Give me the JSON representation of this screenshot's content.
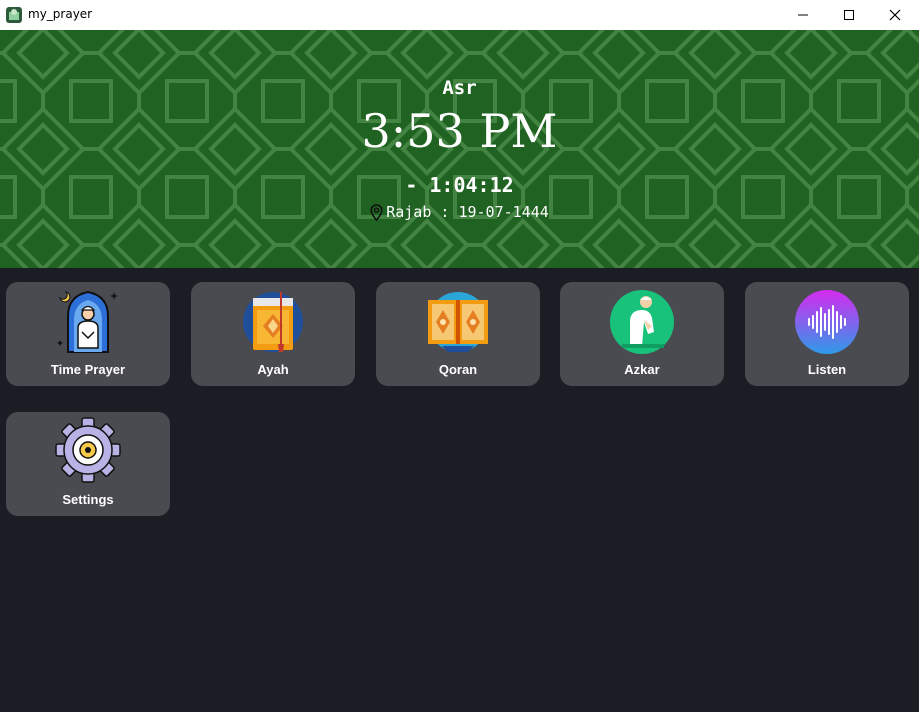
{
  "window": {
    "title": "my_prayer",
    "controls": [
      "minimize",
      "maximize",
      "close"
    ]
  },
  "header": {
    "prayer_name": "Asr",
    "prayer_time": "3:53 PM",
    "remaining": "- 1:04:12",
    "date": "Rajab : 19-07-1444",
    "background_color": "#1f6221",
    "location_icon": "location-pin-icon"
  },
  "menu": {
    "items": [
      {
        "label": "Time Prayer",
        "icon": "praying-man-icon"
      },
      {
        "label": "Ayah",
        "icon": "book-icon"
      },
      {
        "label": "Qoran",
        "icon": "open-quran-icon"
      },
      {
        "label": "Azkar",
        "icon": "praying-person-icon"
      },
      {
        "label": "Listen",
        "icon": "sound-wave-icon"
      },
      {
        "label": "Settings",
        "icon": "gear-icon"
      }
    ]
  },
  "colors": {
    "background": "#1c1d24",
    "card": "#4a4a51",
    "accent_green": "#1f6221"
  }
}
